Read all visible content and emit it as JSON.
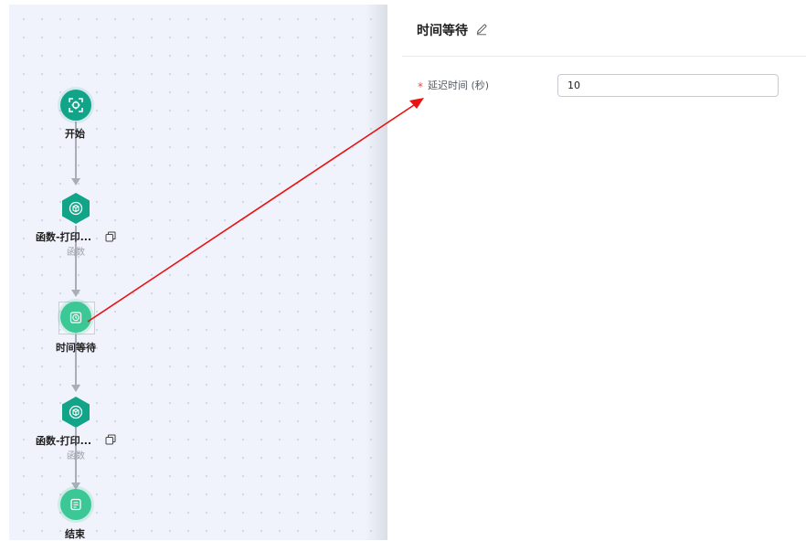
{
  "canvas": {
    "nodes": [
      {
        "label": "开始",
        "icon": "target-scan-icon"
      },
      {
        "label": "函数-打印...",
        "sub": "函数",
        "icon": "cube-icon"
      },
      {
        "label": "时间等待",
        "icon": "clock-icon"
      },
      {
        "label": "函数-打印...",
        "sub": "函数",
        "icon": "cube-icon"
      },
      {
        "label": "结束",
        "icon": "document-list-icon"
      }
    ]
  },
  "panel": {
    "title": "时间等待",
    "required_mark": "*",
    "field_label": "延迟时间 (秒)",
    "field_value": "10"
  },
  "colors": {
    "accent": "#12a489",
    "accent_light": "#3cc796",
    "annotation_arrow": "#e81414"
  }
}
